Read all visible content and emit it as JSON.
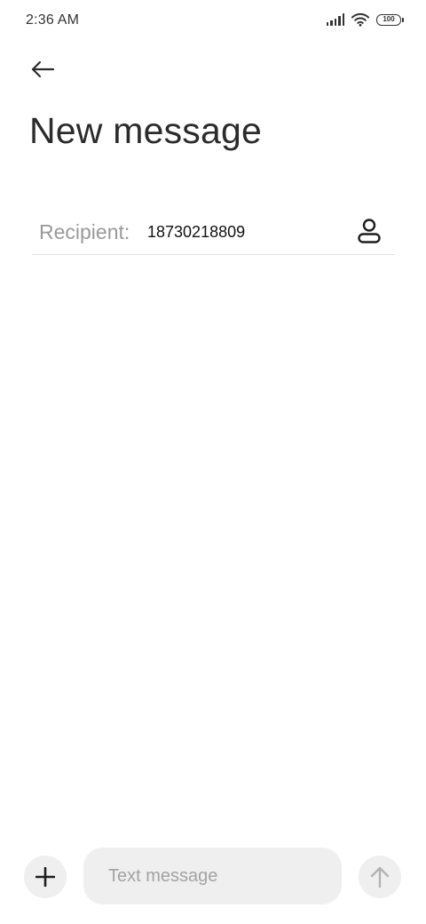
{
  "status_bar": {
    "time": "2:36 AM",
    "battery": "100",
    "icons": [
      "signal-icon",
      "wifi-icon",
      "battery-icon"
    ]
  },
  "header": {
    "back_icon": "arrow-left-icon",
    "title": "New message"
  },
  "recipient": {
    "label": "Recipient:",
    "value": "18730218809",
    "contact_icon": "person-icon"
  },
  "composer": {
    "add_icon": "plus-icon",
    "placeholder": "Text message",
    "value": "",
    "send_icon": "arrow-up-icon"
  },
  "colors": {
    "background": "#ffffff",
    "text": "#2b2b2b",
    "muted": "#9a9a9a",
    "pill": "#efefef",
    "send_disabled": "#b3b3b3"
  }
}
